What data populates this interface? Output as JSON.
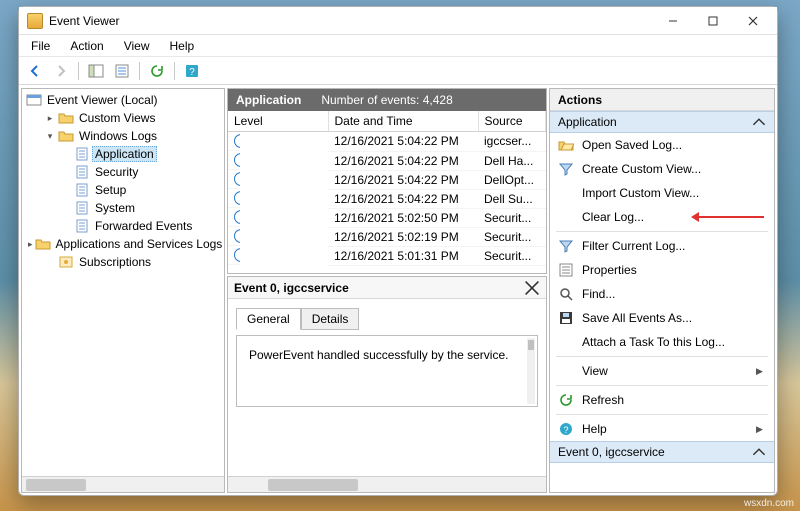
{
  "window": {
    "title": "Event Viewer"
  },
  "menubar": [
    "File",
    "Action",
    "View",
    "Help"
  ],
  "tree": {
    "root": "Event Viewer (Local)",
    "items": [
      {
        "label": "Custom Views",
        "depth": 1,
        "expander": "▸",
        "icon": "folder"
      },
      {
        "label": "Windows Logs",
        "depth": 1,
        "expander": "▾",
        "icon": "folder"
      },
      {
        "label": "Application",
        "depth": 2,
        "expander": "",
        "icon": "log",
        "selected": true
      },
      {
        "label": "Security",
        "depth": 2,
        "expander": "",
        "icon": "log"
      },
      {
        "label": "Setup",
        "depth": 2,
        "expander": "",
        "icon": "log"
      },
      {
        "label": "System",
        "depth": 2,
        "expander": "",
        "icon": "log"
      },
      {
        "label": "Forwarded Events",
        "depth": 2,
        "expander": "",
        "icon": "log"
      },
      {
        "label": "Applications and Services Logs",
        "depth": 1,
        "expander": "▸",
        "icon": "folder"
      },
      {
        "label": "Subscriptions",
        "depth": 1,
        "expander": "",
        "icon": "subs"
      }
    ]
  },
  "events_header": {
    "name": "Application",
    "count_label": "Number of events: 4,428"
  },
  "columns": [
    "Level",
    "Date and Time",
    "Source"
  ],
  "rows": [
    {
      "level": "Information",
      "dt": "12/16/2021 5:04:22 PM",
      "src": "igccser..."
    },
    {
      "level": "Information",
      "dt": "12/16/2021 5:04:22 PM",
      "src": "Dell Ha..."
    },
    {
      "level": "Information",
      "dt": "12/16/2021 5:04:22 PM",
      "src": "DellOpt..."
    },
    {
      "level": "Information",
      "dt": "12/16/2021 5:04:22 PM",
      "src": "Dell Su..."
    },
    {
      "level": "Information",
      "dt": "12/16/2021 5:02:50 PM",
      "src": "Securit..."
    },
    {
      "level": "Information",
      "dt": "12/16/2021 5:02:19 PM",
      "src": "Securit..."
    },
    {
      "level": "Information",
      "dt": "12/16/2021 5:01:31 PM",
      "src": "Securit..."
    }
  ],
  "detail": {
    "title": "Event 0, igccservice",
    "tabs": {
      "general": "General",
      "details": "Details"
    },
    "message": "PowerEvent handled successfully by the service."
  },
  "actions": {
    "title": "Actions",
    "group1": "Application",
    "items1": [
      {
        "label": "Open Saved Log...",
        "icon": "open"
      },
      {
        "label": "Create Custom View...",
        "icon": "filter"
      },
      {
        "label": "Import Custom View...",
        "icon": ""
      },
      {
        "label": "Clear Log...",
        "icon": "",
        "annotated": true
      },
      {
        "label": "Filter Current Log...",
        "icon": "filter"
      },
      {
        "label": "Properties",
        "icon": "props"
      },
      {
        "label": "Find...",
        "icon": "find"
      },
      {
        "label": "Save All Events As...",
        "icon": "save"
      },
      {
        "label": "Attach a Task To this Log...",
        "icon": ""
      },
      {
        "label": "View",
        "icon": "",
        "submenu": true
      },
      {
        "label": "Refresh",
        "icon": "refresh"
      },
      {
        "label": "Help",
        "icon": "help",
        "submenu": true
      }
    ],
    "group2": "Event 0, igccservice"
  },
  "watermark": "wsxdn.com"
}
